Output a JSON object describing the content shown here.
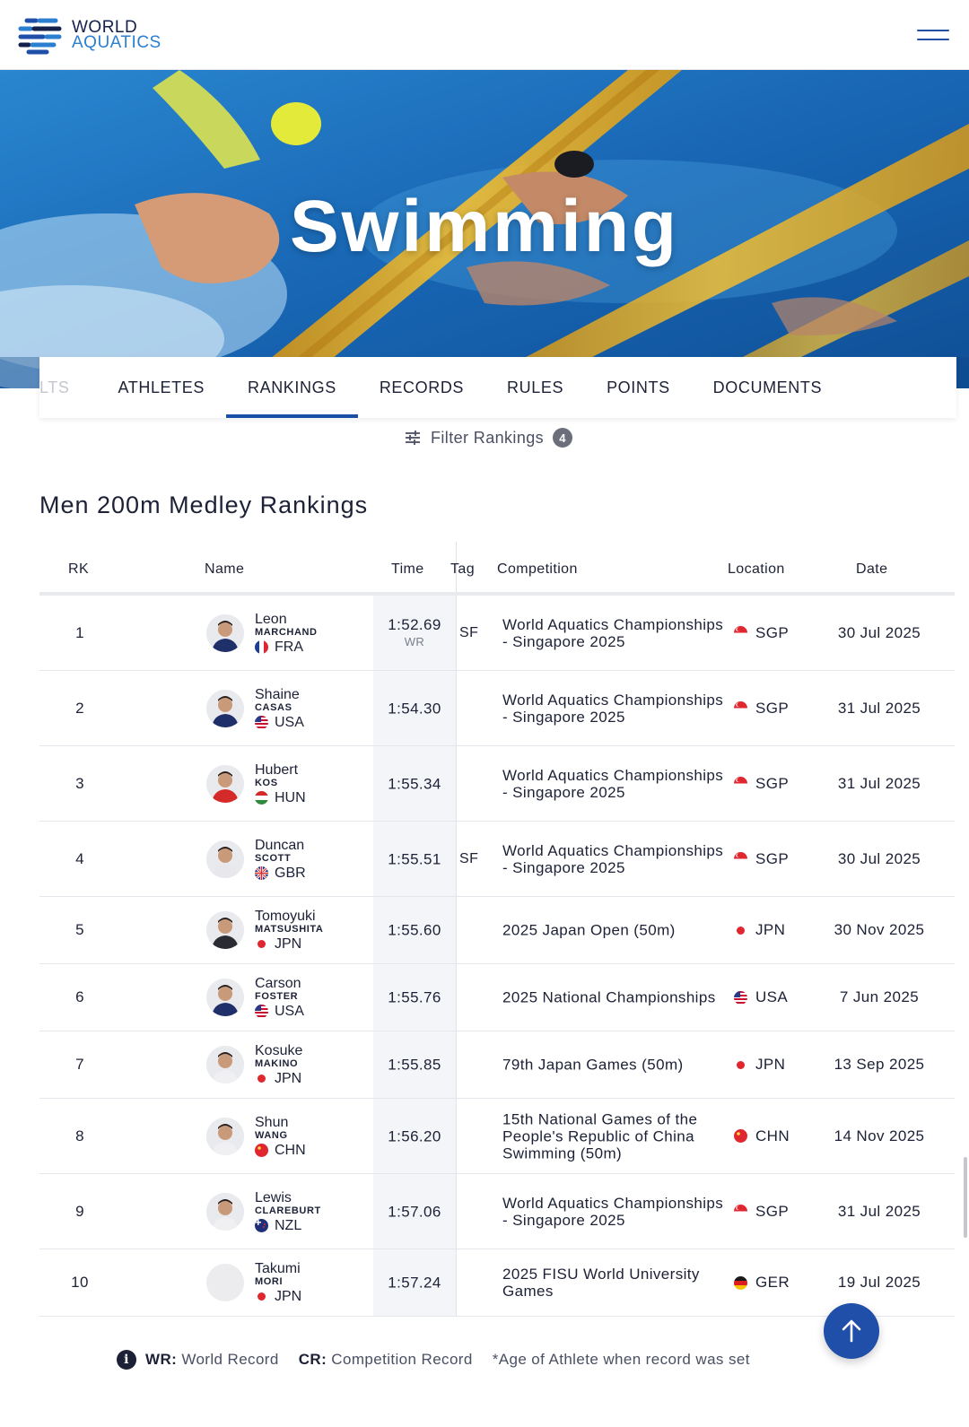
{
  "header": {
    "logo_line1": "WORLD",
    "logo_line2": "AQUATICS",
    "menu_icon": "hamburger-icon"
  },
  "hero": {
    "title": "Swimming"
  },
  "tabs": [
    {
      "label": "LTS",
      "state": "faded"
    },
    {
      "label": "ATHLETES"
    },
    {
      "label": "RANKINGS",
      "state": "active"
    },
    {
      "label": "RECORDS"
    },
    {
      "label": "RULES"
    },
    {
      "label": "POINTS"
    },
    {
      "label": "DOCUMENTS"
    }
  ],
  "filter": {
    "label": "Filter Rankings",
    "count": "4",
    "icon": "sliders-icon"
  },
  "section_title": "Men 200m Medley Rankings",
  "table": {
    "headers": {
      "rk": "RK",
      "name": "Name",
      "time": "Time",
      "tag": "Tag",
      "competition": "Competition",
      "location": "Location",
      "date": "Date"
    },
    "rows": [
      {
        "rk": "1",
        "first": "Leon",
        "last": "MARCHAND",
        "nat": "FRA",
        "time": "1:52.69",
        "record": "WR",
        "tag": "SF",
        "competition": "World Aquatics Championships - Singapore 2025",
        "location": "SGP",
        "date": "30 Jul 2025"
      },
      {
        "rk": "2",
        "first": "Shaine",
        "last": "CASAS",
        "nat": "USA",
        "time": "1:54.30",
        "record": "",
        "tag": "",
        "competition": "World Aquatics Championships - Singapore 2025",
        "location": "SGP",
        "date": "31 Jul 2025"
      },
      {
        "rk": "3",
        "first": "Hubert",
        "last": "KOS",
        "nat": "HUN",
        "time": "1:55.34",
        "record": "",
        "tag": "",
        "competition": "World Aquatics Championships - Singapore 2025",
        "location": "SGP",
        "date": "31 Jul 2025"
      },
      {
        "rk": "4",
        "first": "Duncan",
        "last": "SCOTT",
        "nat": "GBR",
        "time": "1:55.51",
        "record": "",
        "tag": "SF",
        "competition": "World Aquatics Championships - Singapore 2025",
        "location": "SGP",
        "date": "30 Jul 2025"
      },
      {
        "rk": "5",
        "first": "Tomoyuki",
        "last": "MATSUSHITA",
        "nat": "JPN",
        "time": "1:55.60",
        "record": "",
        "tag": "",
        "competition": "2025 Japan Open (50m)",
        "location": "JPN",
        "date": "30 Nov 2025"
      },
      {
        "rk": "6",
        "first": "Carson",
        "last": "FOSTER",
        "nat": "USA",
        "time": "1:55.76",
        "record": "",
        "tag": "",
        "competition": "2025 National Championships",
        "location": "USA",
        "date": "7 Jun 2025"
      },
      {
        "rk": "7",
        "first": "Kosuke",
        "last": "MAKINO",
        "nat": "JPN",
        "time": "1:55.85",
        "record": "",
        "tag": "",
        "competition": "79th Japan Games (50m)",
        "location": "JPN",
        "date": "13 Sep 2025"
      },
      {
        "rk": "8",
        "first": "Shun",
        "last": "WANG",
        "nat": "CHN",
        "time": "1:56.20",
        "record": "",
        "tag": "",
        "competition": "15th National Games of the People's Republic of China Swimming (50m)",
        "location": "CHN",
        "date": "14 Nov 2025"
      },
      {
        "rk": "9",
        "first": "Lewis",
        "last": "CLAREBURT",
        "nat": "NZL",
        "time": "1:57.06",
        "record": "",
        "tag": "",
        "competition": "World Aquatics Championships - Singapore 2025",
        "location": "SGP",
        "date": "31 Jul 2025"
      },
      {
        "rk": "10",
        "first": "Takumi",
        "last": "MORI",
        "nat": "JPN",
        "time": "1:57.24",
        "record": "",
        "tag": "",
        "competition": "2025 FISU World University Games",
        "location": "GER",
        "date": "19 Jul 2025"
      }
    ]
  },
  "legend": {
    "wr_key": "WR:",
    "wr_val": "World Record",
    "cr_key": "CR:",
    "cr_val": "Competition Record",
    "age_note": "*Age of Athlete when record was set"
  },
  "colors": {
    "brand_navy": "#1f4fa8",
    "brand_blue": "#2a7fd1",
    "text": "#1d2136"
  },
  "scroll_top_icon": "arrow-up-icon"
}
